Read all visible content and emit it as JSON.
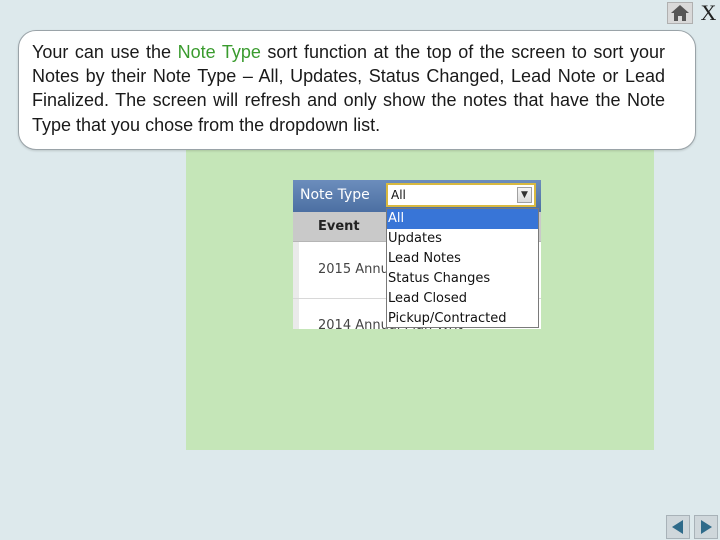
{
  "window": {
    "home_icon": "home-icon",
    "close_label": "X"
  },
  "callout": {
    "text_1": "Your can use the ",
    "highlight": "Note Type",
    "text_2": " sort function at the top of the screen to sort your Notes by their Note Type – All, Updates, Status Changed, Lead Note or Lead Finalized.  The screen will refresh and only show the notes that have the Note Type that you chose from the dropdown list.",
    "highlight_color": "#3a9b2e"
  },
  "screenshot": {
    "filter_label": "Note Type",
    "select_value": "All",
    "column_header": "Event",
    "rows": [
      {
        "text": "2015 Annu"
      },
      {
        "text": "2014 Annual Plan Writ"
      }
    ],
    "dropdown_options": [
      "All",
      "Updates",
      "Lead Notes",
      "Status Changes",
      "Lead Closed",
      "Pickup/Contracted"
    ],
    "selected_option": "All",
    "header_color": "#4c6fa2",
    "selection_color": "#3875d7"
  },
  "navigation": {
    "prev_icon": "arrow-left-icon",
    "next_icon": "arrow-right-icon"
  },
  "colors": {
    "background": "#dde9ec",
    "panel": "#c5e6b8"
  }
}
